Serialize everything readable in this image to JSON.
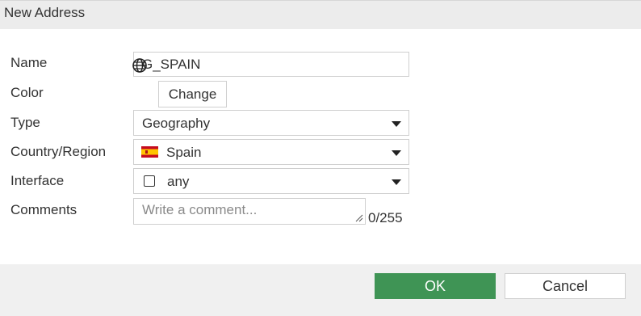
{
  "dialog": {
    "title": "New Address"
  },
  "form": {
    "name": {
      "label": "Name",
      "value": "G_SPAIN"
    },
    "color": {
      "label": "Color",
      "icon": "globe-icon",
      "change_label": "Change"
    },
    "type": {
      "label": "Type",
      "value": "Geography"
    },
    "country_region": {
      "label": "Country/Region",
      "value": "Spain",
      "icon": "spain-flag-icon"
    },
    "interface": {
      "label": "Interface",
      "value": "any",
      "icon": "interface-checkbox-icon"
    },
    "comments": {
      "label": "Comments",
      "placeholder": "Write a comment...",
      "char_count": "0/255"
    }
  },
  "footer": {
    "ok_label": "OK",
    "cancel_label": "Cancel"
  },
  "colors": {
    "header_bg": "#ececec",
    "footer_bg": "#f0f0f0",
    "ok_button_bg": "#3f9455",
    "border": "#cfcfcf",
    "placeholder_text": "#8a8a8a"
  }
}
